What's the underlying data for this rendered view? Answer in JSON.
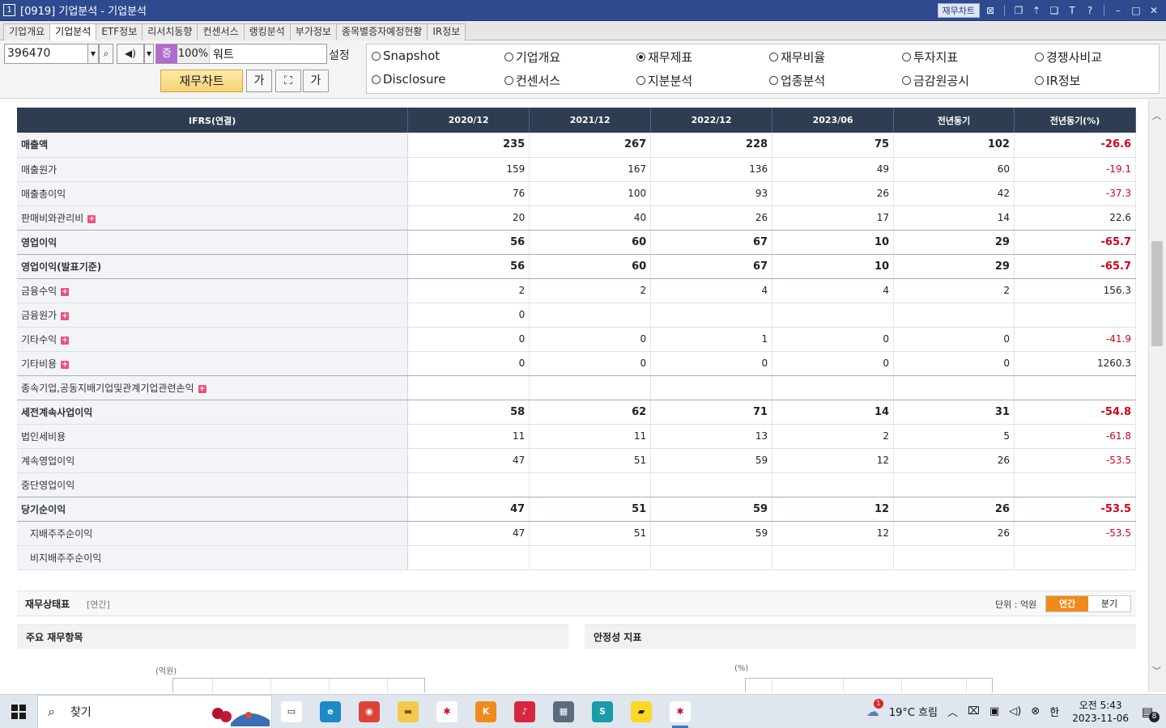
{
  "window": {
    "number": "1",
    "title": "[0919] 기업분석 - 기업분석",
    "chip": "재무차트",
    "icons": [
      "screen-icon",
      "restore-icon",
      "pin-icon",
      "window-icon",
      "font-icon",
      "help-icon",
      "minimize-icon",
      "maximize-icon",
      "close-icon"
    ]
  },
  "tabs": [
    "기업개요",
    "기업분석",
    "ETF정보",
    "리서치동향",
    "컨센서스",
    "랭킹분석",
    "부가정보",
    "종목별증자예정현황",
    "IR정보"
  ],
  "active_tab": 1,
  "controls": {
    "code": "396470",
    "jeung": "증",
    "percent": "100%",
    "stock_name": "워트",
    "setting_label": "설정",
    "chart_button": "재무차트",
    "font_btn_1": "가",
    "font_btn_2": "가"
  },
  "radios": [
    {
      "label": "Snapshot",
      "checked": false
    },
    {
      "label": "기업개요",
      "checked": false
    },
    {
      "label": "재무제표",
      "checked": true
    },
    {
      "label": "재무비율",
      "checked": false
    },
    {
      "label": "투자지표",
      "checked": false
    },
    {
      "label": "경쟁사비교",
      "checked": false
    },
    {
      "label": "Disclosure",
      "checked": false
    },
    {
      "label": "컨센서스",
      "checked": false
    },
    {
      "label": "지분분석",
      "checked": false
    },
    {
      "label": "업종분석",
      "checked": false
    },
    {
      "label": "금감원공시",
      "checked": false
    },
    {
      "label": "IR정보",
      "checked": false
    }
  ],
  "table": {
    "headers": [
      "IFRS(연결)",
      "2020/12",
      "2021/12",
      "2022/12",
      "2023/06",
      "전년동기",
      "전년동기(%)"
    ],
    "rows": [
      {
        "label": "매출액",
        "values": [
          "235",
          "267",
          "228",
          "75",
          "102",
          "-26.6"
        ],
        "bold": true,
        "plus": false,
        "indent": false
      },
      {
        "label": "매출원가",
        "values": [
          "159",
          "167",
          "136",
          "49",
          "60",
          "-19.1"
        ],
        "bold": false,
        "plus": false,
        "indent": false
      },
      {
        "label": "매출총이익",
        "values": [
          "76",
          "100",
          "93",
          "26",
          "42",
          "-37.3"
        ],
        "bold": false,
        "plus": false,
        "indent": false
      },
      {
        "label": "판매비와관리비",
        "values": [
          "20",
          "40",
          "26",
          "17",
          "14",
          "22.6"
        ],
        "bold": false,
        "plus": true,
        "indent": false
      },
      {
        "label": "영업이익",
        "values": [
          "56",
          "60",
          "67",
          "10",
          "29",
          "-65.7"
        ],
        "bold": true,
        "plus": false,
        "indent": false
      },
      {
        "label": "영업이익(발표기준)",
        "values": [
          "56",
          "60",
          "67",
          "10",
          "29",
          "-65.7"
        ],
        "bold": true,
        "plus": false,
        "indent": false
      },
      {
        "label": "금융수익",
        "values": [
          "2",
          "2",
          "4",
          "4",
          "2",
          "156.3"
        ],
        "bold": false,
        "plus": true,
        "indent": false
      },
      {
        "label": "금융원가",
        "values": [
          "0",
          "",
          "",
          "",
          "",
          ""
        ],
        "bold": false,
        "plus": true,
        "indent": false
      },
      {
        "label": "기타수익",
        "values": [
          "0",
          "0",
          "1",
          "0",
          "0",
          "-41.9"
        ],
        "bold": false,
        "plus": true,
        "indent": false
      },
      {
        "label": "기타비용",
        "values": [
          "0",
          "0",
          "0",
          "0",
          "0",
          "1260.3"
        ],
        "bold": false,
        "plus": true,
        "indent": false
      },
      {
        "label": "종속기업,공동지배기업및관계기업관련손익",
        "values": [
          "",
          "",
          "",
          "",
          "",
          ""
        ],
        "bold": false,
        "plus": true,
        "indent": false
      },
      {
        "label": "세전계속사업이익",
        "values": [
          "58",
          "62",
          "71",
          "14",
          "31",
          "-54.8"
        ],
        "bold": true,
        "plus": false,
        "indent": false
      },
      {
        "label": "법인세비용",
        "values": [
          "11",
          "11",
          "13",
          "2",
          "5",
          "-61.8"
        ],
        "bold": false,
        "plus": false,
        "indent": false
      },
      {
        "label": "계속영업이익",
        "values": [
          "47",
          "51",
          "59",
          "12",
          "26",
          "-53.5"
        ],
        "bold": false,
        "plus": false,
        "indent": false
      },
      {
        "label": "중단영업이익",
        "values": [
          "",
          "",
          "",
          "",
          "",
          ""
        ],
        "bold": false,
        "plus": false,
        "indent": false
      },
      {
        "label": "당기순이익",
        "values": [
          "47",
          "51",
          "59",
          "12",
          "26",
          "-53.5"
        ],
        "bold": true,
        "plus": false,
        "indent": false
      },
      {
        "label": "지배주주순이익",
        "values": [
          "47",
          "51",
          "59",
          "12",
          "26",
          "-53.5"
        ],
        "bold": false,
        "plus": false,
        "indent": true
      },
      {
        "label": "비지배주주순이익",
        "values": [
          "",
          "",
          "",
          "",
          "",
          ""
        ],
        "bold": false,
        "plus": false,
        "indent": true
      }
    ]
  },
  "section": {
    "title": "재무상태표",
    "subtitle": "[연간]",
    "unit": "단위 : 억원",
    "toggle": [
      "연간",
      "분기"
    ],
    "toggle_active": 0,
    "left_panel": "주요 재무항목",
    "right_panel": "안정성 지표",
    "left_axis_unit": "(억원)",
    "right_axis_unit": "(%)"
  },
  "taskbar": {
    "search_placeholder": "찾기",
    "apps": [
      "task-view-icon",
      "edge-icon",
      "chrome-icon",
      "explorer-icon",
      "securities-app-icon",
      "kakao-icon",
      "trading-app-icon",
      "calculator-icon",
      "browser-app-icon",
      "sticky-notes-icon",
      "securities-app-active-icon"
    ],
    "weather": "19°C  흐림",
    "weather_badge": "1",
    "ime": "한",
    "time": "오전 5:43",
    "date": "2023-11-06",
    "notification_count": "8"
  },
  "colors": {
    "title_bar": "#2f4a8e",
    "header_dark": "#2e3d52",
    "negative": "#d0021b",
    "accent_orange": "#f08a1c",
    "chart_button": "#f6d374"
  }
}
